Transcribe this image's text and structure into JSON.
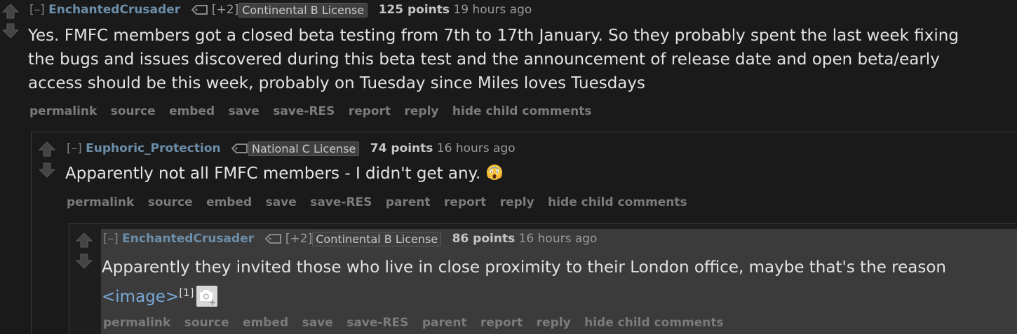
{
  "comments": [
    {
      "expand": "[–]",
      "author": "EnchantedCrusader",
      "flair_count": "[+2]",
      "flair": "Continental B License",
      "score": "125 points",
      "time": "19 hours ago",
      "body": [
        "Yes. FMFC members got a closed beta testing from 7th to 17th January. So they probably spent the last week fixing",
        "the bugs and issues discovered during this beta test and the announcement of release date and open beta/early",
        "access should be this week, probably on Tuesday since Miles loves Tuesdays"
      ],
      "buttons": [
        "permalink",
        "source",
        "embed",
        "save",
        "save-RES",
        "report",
        "reply",
        "hide child comments"
      ]
    },
    {
      "expand": "[–]",
      "author": "Euphoric_Protection",
      "flair": "National C License",
      "score": "74 points",
      "time": "16 hours ago",
      "body": "Apparently not all FMFC members - I didn't get any.",
      "emoji": "screaming-face-emoji",
      "buttons": [
        "permalink",
        "source",
        "embed",
        "save",
        "save-RES",
        "parent",
        "report",
        "reply",
        "hide child comments"
      ]
    },
    {
      "expand": "[–]",
      "author": "EnchantedCrusader",
      "flair_count": "[+2]",
      "flair": "Continental B License",
      "score": "86 points",
      "time": "16 hours ago",
      "body": "Apparently they invited those who live in close proximity to their London office, maybe that's the reason",
      "image_link": "<image>",
      "footnote": "[1]",
      "camera_icon": "camera-icon",
      "buttons": [
        "permalink",
        "source",
        "embed",
        "save",
        "save-RES",
        "parent",
        "report",
        "reply",
        "hide child comments"
      ]
    }
  ],
  "colors": {
    "background": "#1a1a1b",
    "author": "#6c8ea9",
    "highlight": "#3b3b3b",
    "link": "#78a9d8"
  }
}
